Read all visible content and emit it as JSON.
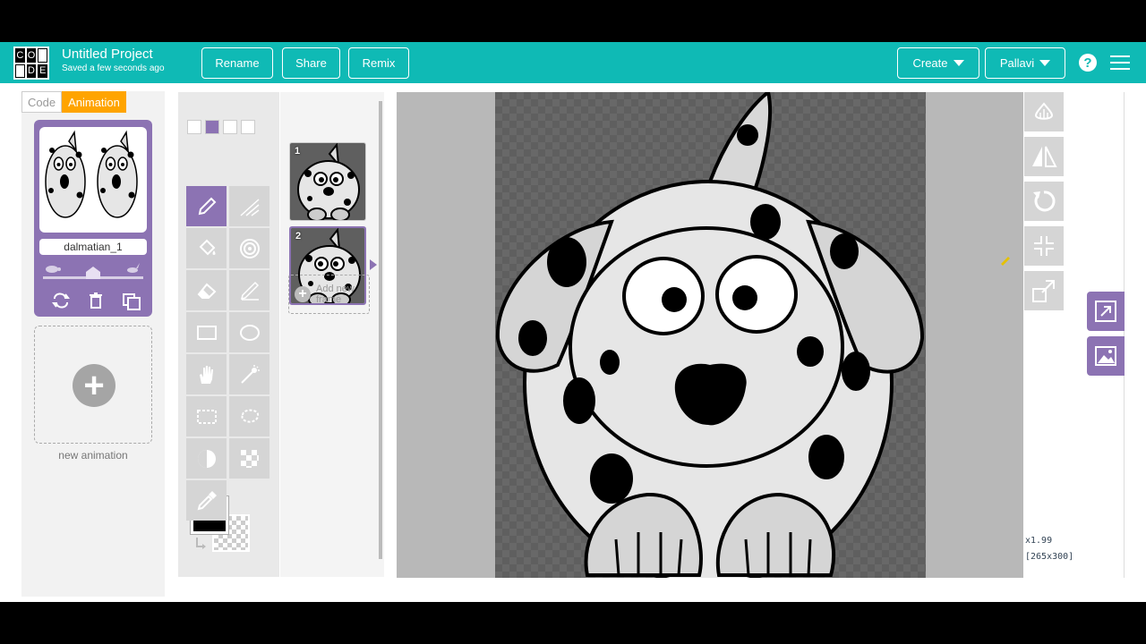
{
  "header": {
    "logo_letters": [
      "C",
      "O",
      "D",
      "E"
    ],
    "project_title": "Untitled Project",
    "saved_status": "Saved a few seconds ago",
    "rename_label": "Rename",
    "share_label": "Share",
    "remix_label": "Remix",
    "create_label": "Create",
    "user_label": "Pallavi",
    "help_glyph": "?",
    "brand_color": "#0fbab5"
  },
  "left_panel": {
    "tabs": [
      {
        "label": "Code",
        "active": false
      },
      {
        "label": "Animation",
        "active": true
      }
    ],
    "animation": {
      "name": "dalmatian_1",
      "frame_rate_fraction": 0.5
    },
    "new_animation_label": "new animation",
    "accent_color": "#8c73b3"
  },
  "tools": {
    "brush_sizes": 4,
    "active_size": 2,
    "items": [
      {
        "icon": "pencil-icon",
        "active": true
      },
      {
        "icon": "line-icon",
        "active": false
      },
      {
        "icon": "bucket-icon",
        "active": false
      },
      {
        "icon": "spiral-icon",
        "active": false
      },
      {
        "icon": "eraser-icon",
        "active": false
      },
      {
        "icon": "pen-icon",
        "active": false
      },
      {
        "icon": "rectangle-icon",
        "active": false
      },
      {
        "icon": "ellipse-icon",
        "active": false
      },
      {
        "icon": "hand-icon",
        "active": false
      },
      {
        "icon": "magic-wand-icon",
        "active": false
      },
      {
        "icon": "rect-select-icon",
        "active": false
      },
      {
        "icon": "lasso-icon",
        "active": false
      },
      {
        "icon": "lighten-icon",
        "active": false
      },
      {
        "icon": "dither-icon",
        "active": false
      },
      {
        "icon": "eyedropper-icon",
        "active": false
      }
    ],
    "primary_color": "#000000",
    "secondary_color": "transparent"
  },
  "frames": {
    "items": [
      {
        "number": "1",
        "selected": false
      },
      {
        "number": "2",
        "selected": true
      }
    ],
    "add_frame_label_1": "Add new",
    "add_frame_label_2": "frame"
  },
  "canvas": {
    "zoom": "x1.99",
    "dimensions": "[265x300]"
  },
  "right_tools": [
    "onion-skin-icon",
    "flip-horizontal-icon",
    "rotate-icon",
    "center-icon",
    "resize-icon"
  ],
  "panel_buttons": [
    "expand-icon",
    "image-icon"
  ],
  "bottom_bar": [
    "pause-icon",
    "pointer-icon",
    "pencil-icon",
    "marker-icon",
    "close-icon"
  ]
}
